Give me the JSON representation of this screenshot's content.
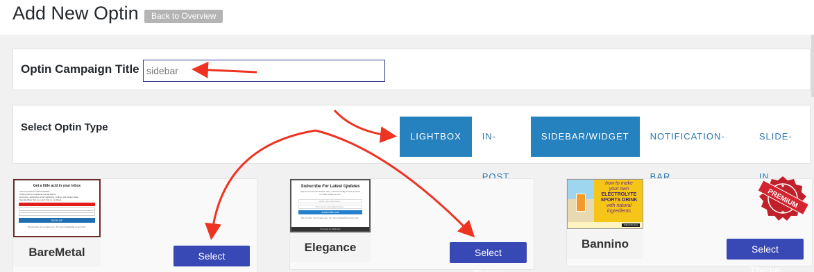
{
  "header": {
    "title": "Add New Optin",
    "back_label": "Back to Overview"
  },
  "campaign": {
    "label": "Optin Campaign Title",
    "value": "sidebar"
  },
  "optin_type": {
    "label": "Select Optin Type",
    "tabs": [
      {
        "label": "LIGHTBOX",
        "active": true
      },
      {
        "label": "IN-POST",
        "active": false
      },
      {
        "label": "SIDEBAR/WIDGET",
        "active": true
      },
      {
        "label": "NOTIFICATION-BAR",
        "active": false
      },
      {
        "label": "SLIDE-IN",
        "active": false
      }
    ]
  },
  "themes": [
    {
      "name": "BareMetal",
      "button": "Select Theme",
      "preview": {
        "heading": "Get a little acid in your inbox",
        "bullets": [
          "Free conversion email templates",
          "Cutting tips for freelancers email clients",
          "Exclusive, actionable email marketing, coding, and design ideas",
          "Special offers that you won't find on our blogs"
        ],
        "cta": "SIGN UP",
        "footer": "We promise not to spam you. You can unsubscribe at any time."
      }
    },
    {
      "name": "Elegance",
      "button": "Select Theme",
      "preview": {
        "heading": "Subscribe For Latest Updates",
        "subtext": "Signup to best of business news, informed analysis and opinions on what matters to you.",
        "field1": "Enter your name here...",
        "field2": "Enter your email address here...",
        "cta": "SUBSCRIBE NOW",
        "footer": "We promise not to spam you. You can unsubscribe at any time.",
        "powered": "Powered by MailOptin"
      }
    },
    {
      "name": "Bannino",
      "button": "Select Theme",
      "badge": "PREMIUM",
      "preview": {
        "line1": "how to make",
        "line2": "your own",
        "line3": "ELECTROLYTE",
        "line4": "SPORTS DRINK",
        "line5": "with natural",
        "line6": "ingredients",
        "cta": "Subscribe Now"
      }
    }
  ],
  "colors": {
    "accent": "#2681bf",
    "button": "#3848b4",
    "arrow": "#ee3322"
  }
}
